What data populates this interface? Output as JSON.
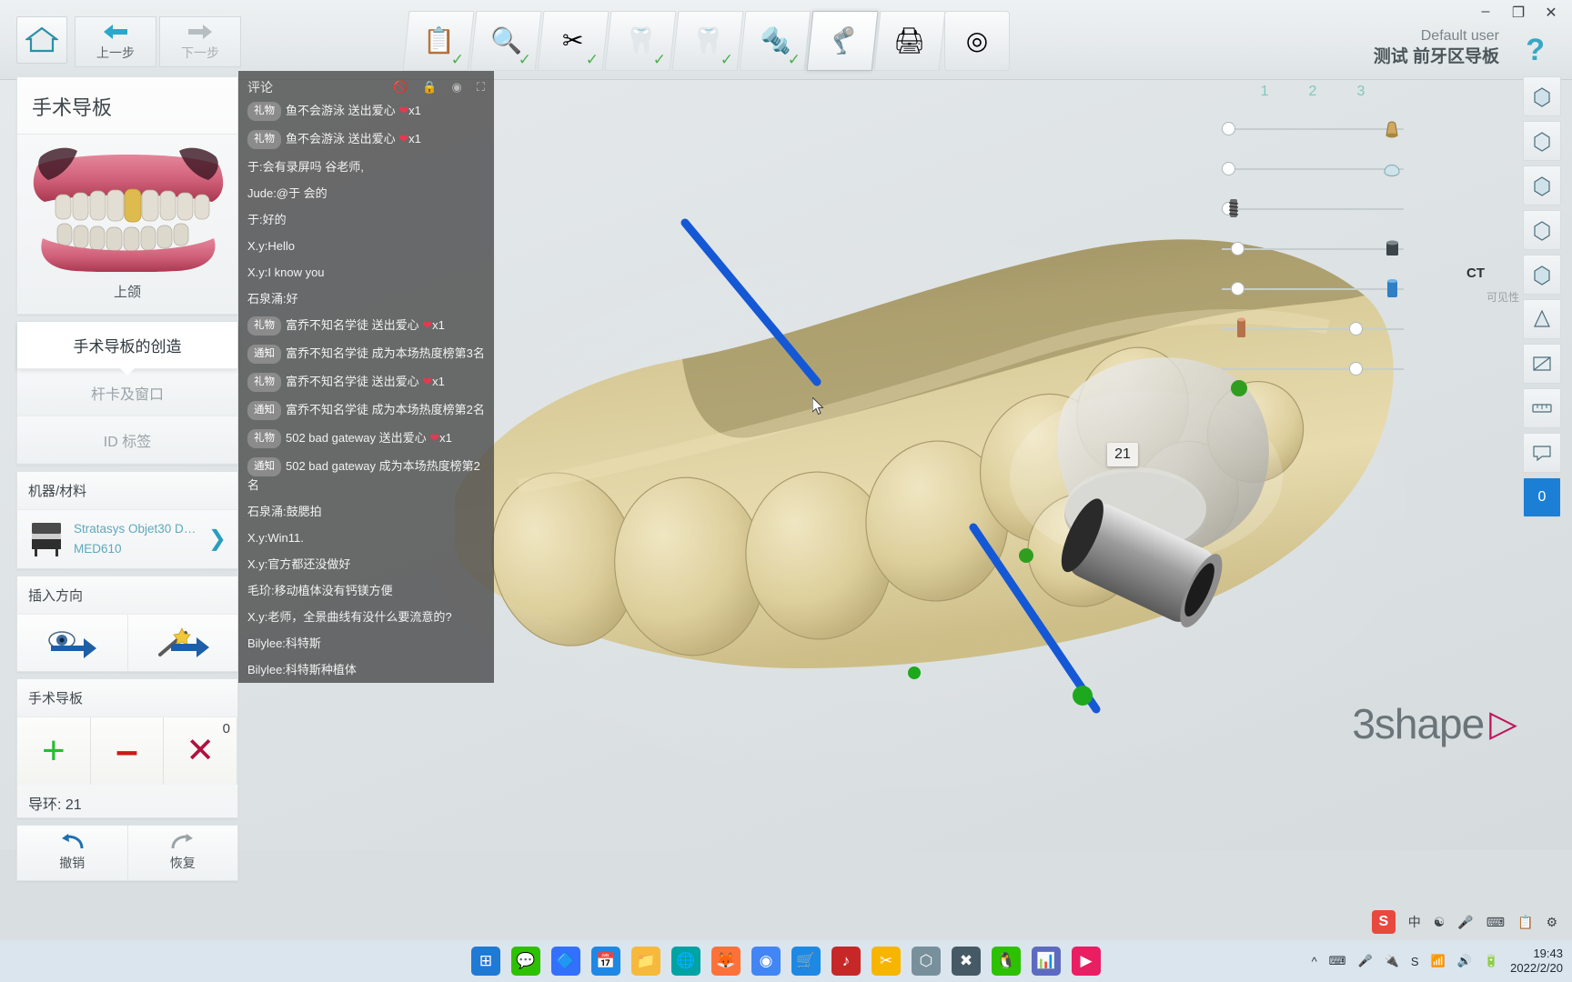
{
  "window": {
    "minimize": "–",
    "maximize": "❐",
    "close": "✕"
  },
  "topbar": {
    "home_icon": "home-icon",
    "prev_label": "上一步",
    "next_label": "下一步",
    "steps": [
      {
        "name": "order-form",
        "glyph": "📋",
        "checked": true,
        "active": false
      },
      {
        "name": "scan",
        "glyph": "🔍",
        "checked": true,
        "active": false
      },
      {
        "name": "trim",
        "glyph": "✂",
        "checked": true,
        "active": false
      },
      {
        "name": "tooth-design",
        "glyph": "🦷",
        "checked": true,
        "active": false
      },
      {
        "name": "anatomy",
        "glyph": "👁",
        "checked": true,
        "active": false
      },
      {
        "name": "implant",
        "glyph": "🔩",
        "checked": true,
        "active": false
      },
      {
        "name": "surgical-guide",
        "glyph": "🦿",
        "checked": false,
        "active": true
      },
      {
        "name": "manufacture",
        "glyph": "🖨",
        "checked": false,
        "active": false
      },
      {
        "name": "finish",
        "glyph": "◎",
        "checked": false,
        "active": false
      }
    ]
  },
  "user": {
    "name": "Default user",
    "case": "测试 前牙区导板",
    "help": "?"
  },
  "sidebar": {
    "title": "手术导板",
    "preview_label": "上颌",
    "tabs": [
      {
        "label": "手术导板的创造",
        "selected": true
      },
      {
        "label": "杆卡及窗口",
        "selected": false
      },
      {
        "label": "ID 标签",
        "selected": false
      }
    ],
    "machine_section": {
      "heading": "机器/材料",
      "machine": "Stratasys Objet30 Dental...",
      "material": "MED610",
      "chevron": "❯"
    },
    "insertion_section": {
      "heading": "插入方向",
      "buttons": [
        {
          "name": "set-from-view-direction",
          "glyph": "view-arrow-icon"
        },
        {
          "name": "auto-insertion-direction",
          "glyph": "magic-arrow-icon"
        }
      ]
    },
    "guide_section": {
      "heading": "手术导板",
      "add_label": "+",
      "remove_label": "–",
      "delete_label": "✕",
      "count": "0"
    },
    "ring_label": "导环: 21",
    "undo_label": "撤销",
    "redo_label": "恢复"
  },
  "chat": {
    "title": "评论",
    "icons": [
      "no-comment-icon",
      "lock-icon",
      "settings-icon",
      "expand-icon"
    ],
    "messages": [
      {
        "tag": "礼物",
        "text": "鱼不会游泳 送出爱心 ❤x1"
      },
      {
        "tag": "礼物",
        "text": "鱼不会游泳 送出爱心 ❤x1"
      },
      {
        "tag": "",
        "text": "于:会有录屏吗 谷老师,"
      },
      {
        "tag": "",
        "text": "Jude:@于 会的"
      },
      {
        "tag": "",
        "text": "于:好的"
      },
      {
        "tag": "",
        "text": "X.y:Hello"
      },
      {
        "tag": "",
        "text": "X.y:I know you"
      },
      {
        "tag": "",
        "text": "石泉涌:好"
      },
      {
        "tag": "礼物",
        "text": "富乔不知名学徒 送出爱心 ❤x1"
      },
      {
        "tag": "通知",
        "text": "富乔不知名学徒 成为本场热度榜第3名"
      },
      {
        "tag": "礼物",
        "text": "富乔不知名学徒 送出爱心 ❤x1"
      },
      {
        "tag": "通知",
        "text": "富乔不知名学徒 成为本场热度榜第2名"
      },
      {
        "tag": "礼物",
        "text": "502 bad gateway 送出爱心 ❤x1"
      },
      {
        "tag": "通知",
        "text": "502 bad gateway 成为本场热度榜第2名"
      },
      {
        "tag": "",
        "text": "石泉涌:鼓腮拍"
      },
      {
        "tag": "",
        "text": "X.y:Win11."
      },
      {
        "tag": "",
        "text": "X.y:官方都还没做好"
      },
      {
        "tag": "",
        "text": "毛玠:移动植体没有钙镁方便"
      },
      {
        "tag": "",
        "text": "X.y:老师，全景曲线有没什么要流意的?"
      },
      {
        "tag": "",
        "text": "Bilylee:科特斯"
      },
      {
        "tag": "",
        "text": "Bilylee:科特斯种植体"
      }
    ]
  },
  "rail": {
    "numbers": [
      "1",
      "2",
      "3"
    ],
    "sliders": [
      {
        "name": "abutment-visibility",
        "icon": "abutment-icon",
        "value": 0
      },
      {
        "name": "crown-visibility",
        "icon": "crown-icon",
        "value": 0
      },
      {
        "name": "implant-visibility",
        "icon": "implant-screw-icon",
        "value": 0
      },
      {
        "name": "sleeve-visibility",
        "icon": "sleeve-icon",
        "value": 5
      },
      {
        "name": "guide-visibility",
        "icon": "guide-cylinder-icon",
        "value": 5
      },
      {
        "name": "drill-visibility",
        "icon": "drill-icon",
        "value": 70
      },
      {
        "name": "ct-visibility",
        "icon": "ct-icon",
        "value": 70
      }
    ],
    "ct_label": "CT",
    "extra_label": "可见性"
  },
  "right_column": {
    "buttons": [
      {
        "name": "view-front",
        "glyph": "❐"
      },
      {
        "name": "view-back",
        "glyph": "❐"
      },
      {
        "name": "view-left",
        "glyph": "❐"
      },
      {
        "name": "view-right",
        "glyph": "❐"
      },
      {
        "name": "view-top",
        "glyph": "❐"
      },
      {
        "name": "view-occlusal",
        "glyph": "❐"
      },
      {
        "name": "view-section",
        "glyph": "◢"
      },
      {
        "name": "measure-tool",
        "glyph": "📏"
      },
      {
        "name": "annotation-tool",
        "glyph": "💬"
      },
      {
        "name": "layer-count-badge",
        "glyph": "0",
        "badge": true
      }
    ]
  },
  "viewport": {
    "implant_number": "21",
    "logo_text": "3shape",
    "logo_mark": "▷"
  },
  "taskbar": {
    "apps": [
      {
        "name": "start-button",
        "glyph": "⊞",
        "color": "#1f7ad4"
      },
      {
        "name": "wechat-app",
        "glyph": "💬",
        "color": "#2dc100"
      },
      {
        "name": "feishu-app",
        "glyph": "🔷",
        "color": "#3370ff"
      },
      {
        "name": "calendar-app",
        "glyph": "📅",
        "color": "#1e88e5"
      },
      {
        "name": "explorer-app",
        "glyph": "📁",
        "color": "#f6b93b"
      },
      {
        "name": "browser-app",
        "glyph": "🌐",
        "color": "#00a3a3"
      },
      {
        "name": "firefox-app",
        "glyph": "🦊",
        "color": "#ff7139"
      },
      {
        "name": "chrome-app",
        "glyph": "◉",
        "color": "#4285f4"
      },
      {
        "name": "store-app",
        "glyph": "🛒",
        "color": "#1e88e5"
      },
      {
        "name": "netease-app",
        "glyph": "♪",
        "color": "#c62828"
      },
      {
        "name": "snipaste-app",
        "glyph": "✂",
        "color": "#f7b500"
      },
      {
        "name": "3d-app",
        "glyph": "⬡",
        "color": "#78909c"
      },
      {
        "name": "design-app",
        "glyph": "✖",
        "color": "#455a64"
      },
      {
        "name": "qq-app",
        "glyph": "🐧",
        "color": "#2dc100"
      },
      {
        "name": "chart-app",
        "glyph": "📊",
        "color": "#5c6bc0"
      },
      {
        "name": "media-player-app",
        "glyph": "▶",
        "color": "#e91e63"
      }
    ],
    "tray": [
      {
        "name": "show-hidden-icons",
        "glyph": "⌃"
      },
      {
        "name": "keyboard-icon",
        "glyph": "⌨"
      },
      {
        "name": "microphone-icon",
        "glyph": "🎤"
      },
      {
        "name": "usb-icon",
        "glyph": "🔌"
      },
      {
        "name": "snipaste-tray-icon",
        "glyph": "S"
      },
      {
        "name": "network-icon",
        "glyph": "📶"
      },
      {
        "name": "volume-icon",
        "glyph": "🔊"
      },
      {
        "name": "battery-icon",
        "glyph": "🔋"
      }
    ],
    "time": "19:43",
    "date": "2022/2/20"
  },
  "ime": {
    "lang": "中",
    "items": [
      "☯",
      "🎤",
      "⌨",
      "📋",
      "⚙"
    ]
  }
}
